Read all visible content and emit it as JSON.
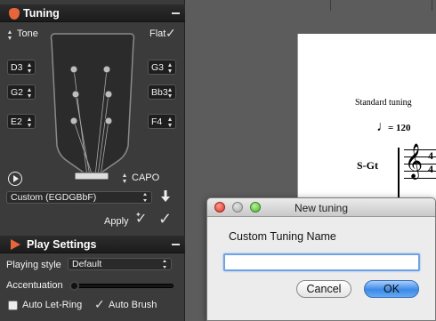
{
  "tuning_panel": {
    "title": "Tuning",
    "tone_label": "Tone",
    "flat_label": "Flat",
    "flat_checked": true,
    "strings_left": [
      "D3",
      "G2",
      "E2"
    ],
    "strings_right": [
      "G3",
      "Bb3",
      "F4"
    ],
    "capo_label": "CAPO",
    "tuning_select": "Custom (EGDGBbF)",
    "apply_label": "Apply"
  },
  "play_settings": {
    "title": "Play Settings",
    "playing_style_label": "Playing style",
    "playing_style_value": "Default",
    "accentuation_label": "Accentuation",
    "accentuation_level": 0,
    "auto_let_ring_label": "Auto Let-Ring",
    "auto_let_ring_checked": false,
    "auto_brush_label": "Auto Brush",
    "auto_brush_checked": true
  },
  "score": {
    "tuning_text": "Standard tuning",
    "tempo_value": "= 120",
    "track_label": "S-Gt",
    "time_signature": [
      "4",
      "4"
    ]
  },
  "dialog": {
    "title": "New tuning",
    "prompt": "Custom Tuning Name",
    "input_value": "",
    "cancel_label": "Cancel",
    "ok_label": "OK"
  },
  "colors": {
    "accent": "#e8643a",
    "panel_bg": "#3b3b3b",
    "ok_button": "#3b8ae6"
  }
}
